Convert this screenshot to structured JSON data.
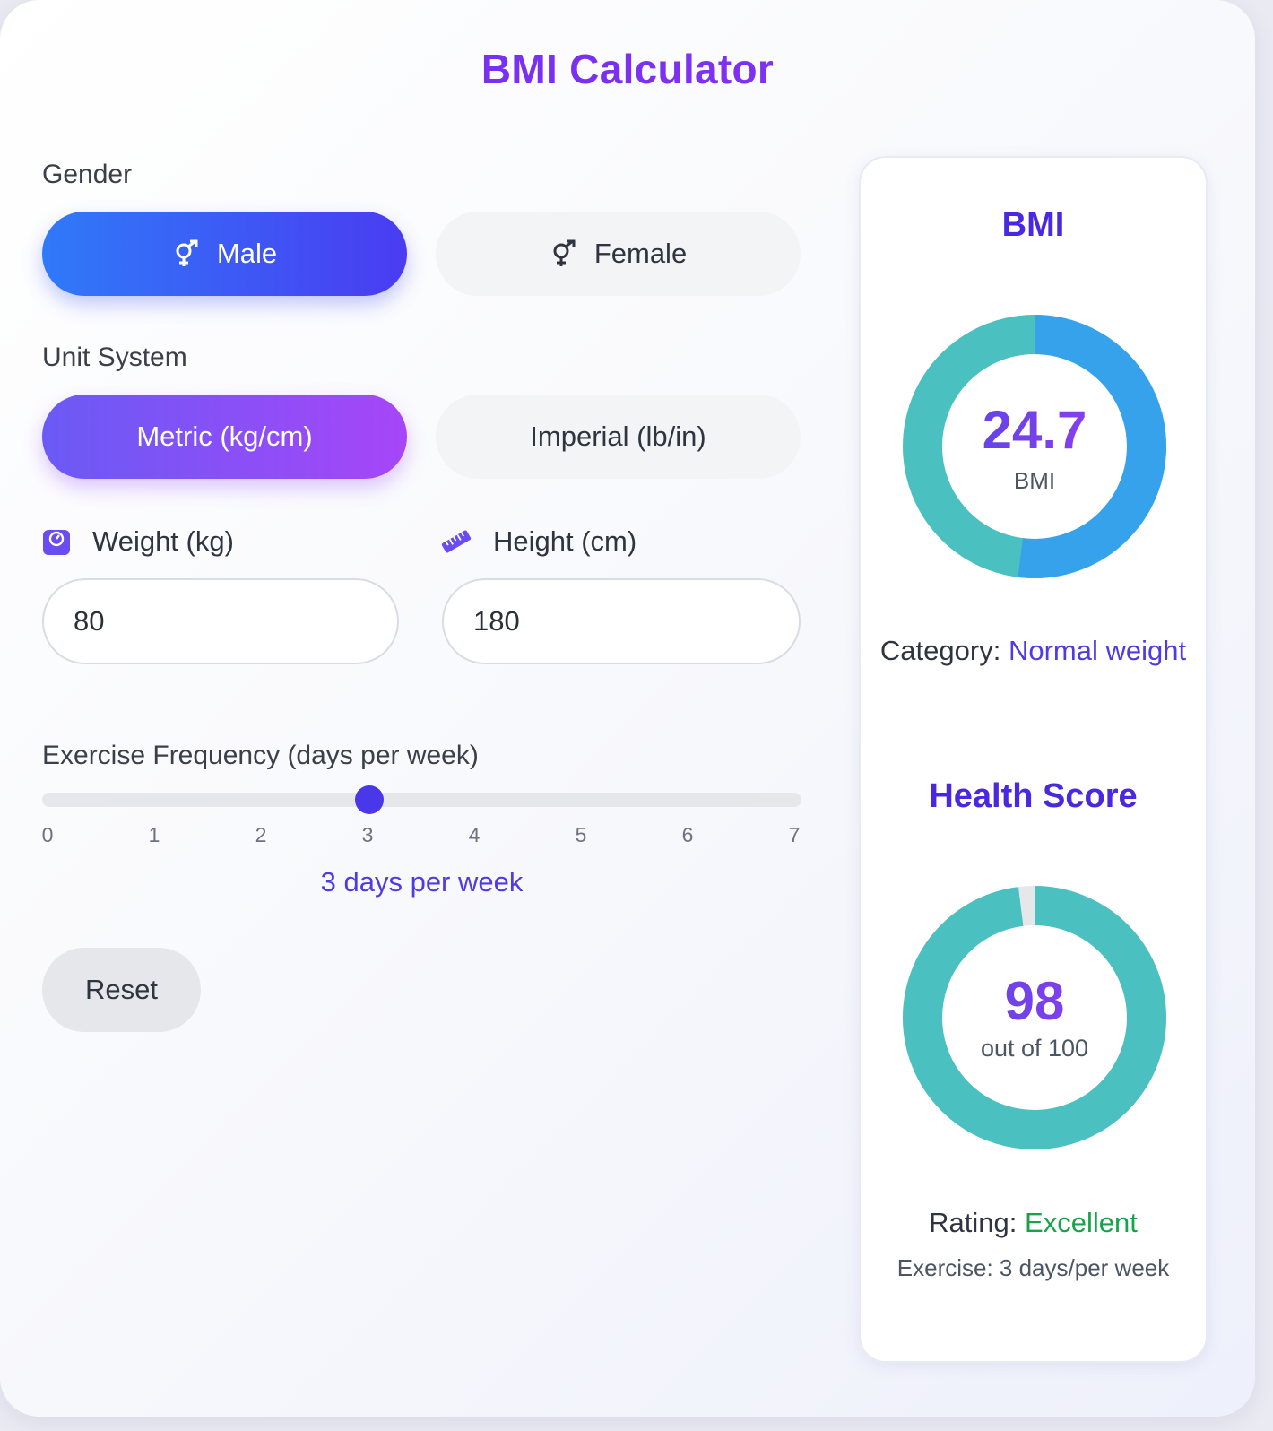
{
  "title": "BMI Calculator",
  "gender": {
    "label": "Gender",
    "options": [
      {
        "label": "Male",
        "selected": true
      },
      {
        "label": "Female",
        "selected": false
      }
    ]
  },
  "units": {
    "label": "Unit System",
    "options": [
      {
        "label": "Metric (kg/cm)",
        "selected": true
      },
      {
        "label": "Imperial (lb/in)",
        "selected": false
      }
    ]
  },
  "weight": {
    "label": "Weight (kg)",
    "value": "80",
    "icon": "scale-icon"
  },
  "height": {
    "label": "Height (cm)",
    "value": "180",
    "icon": "ruler-icon"
  },
  "exercise": {
    "label": "Exercise Frequency (days per week)",
    "min": 0,
    "max": 7,
    "value": 3,
    "ticks": [
      "0",
      "1",
      "2",
      "3",
      "4",
      "5",
      "6",
      "7"
    ],
    "readout": "3 days per week"
  },
  "reset_label": "Reset",
  "results": {
    "bmi": {
      "heading": "BMI",
      "value": "24.7",
      "unit": "BMI",
      "ring_fraction": 0.52,
      "category_label": "Category:",
      "category_value": "Normal weight"
    },
    "health": {
      "heading": "Health Score",
      "value": "98",
      "max_text": "out of 100",
      "score_fraction": 0.98,
      "rating_label": "Rating:",
      "rating_value": "Excellent",
      "exercise_text": "Exercise: 3 days/per week"
    }
  },
  "colors": {
    "ring_blue": "#36a2eb",
    "ring_teal": "#4bc0c0",
    "ring_empty": "#e6e7ea",
    "accent": "#4f3be3",
    "rating_good": "#16a34a"
  }
}
